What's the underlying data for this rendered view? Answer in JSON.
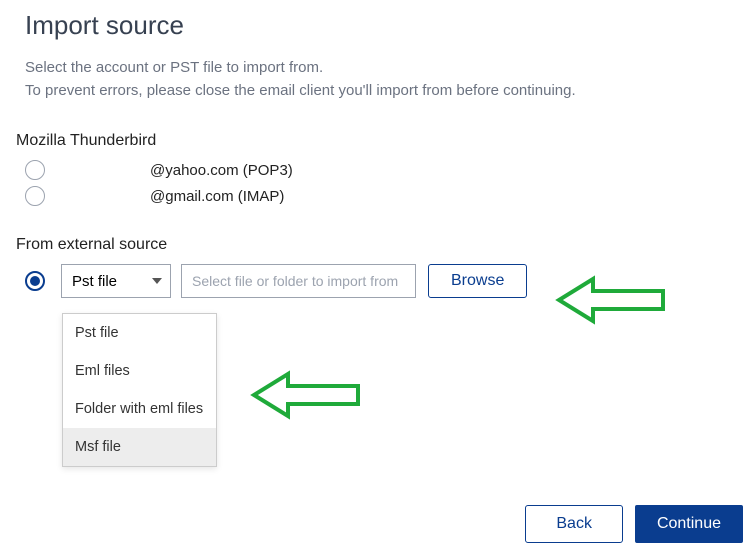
{
  "title": "Import source",
  "subtitle_line1": "Select the account or PST file to import from.",
  "subtitle_line2": "To prevent errors, please close the email client you'll import from before continuing.",
  "section_tb": "Mozilla Thunderbird",
  "accounts": [
    {
      "label": "@yahoo.com  (POP3)",
      "selected": false
    },
    {
      "label": "@gmail.com  (IMAP)",
      "selected": false
    }
  ],
  "section_ext": "From external source",
  "ext_selected": true,
  "select_value": "Pst file",
  "path_placeholder": "Select file or folder to import from",
  "browse_label": "Browse",
  "dropdown_items": [
    "Pst file",
    "Eml files",
    "Folder with eml files",
    "Msf file"
  ],
  "dropdown_highlight_index": 3,
  "back_label": "Back",
  "continue_label": "Continue",
  "colors": {
    "accent": "#0a3d8f",
    "arrow": "#1faa3a"
  }
}
